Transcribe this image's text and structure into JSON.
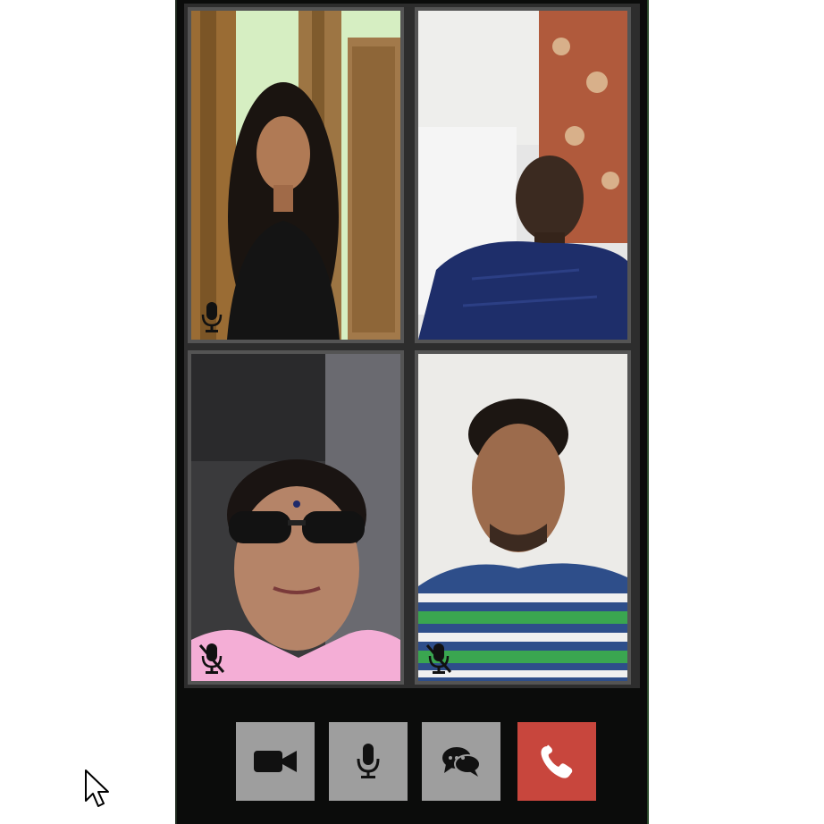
{
  "call": {
    "participants": [
      {
        "tile": "participant-tile-1",
        "mic": "on"
      },
      {
        "tile": "participant-tile-2",
        "mic": "hidden"
      },
      {
        "tile": "participant-tile-3",
        "mic": "muted"
      },
      {
        "tile": "participant-tile-4",
        "mic": "muted"
      }
    ]
  },
  "controls": [
    {
      "name": "camera-button",
      "icon": "video-camera-icon"
    },
    {
      "name": "microphone-button",
      "icon": "microphone-icon"
    },
    {
      "name": "chat-button",
      "icon": "chat-bubbles-icon"
    },
    {
      "name": "end-call-button",
      "icon": "phone-hangup-icon",
      "color": "#c8463d"
    }
  ],
  "colors": {
    "app_background": "#0b0c0b",
    "tile_border": "#545454",
    "button_gray": "#9e9e9e",
    "end_call_red": "#c8463d"
  }
}
